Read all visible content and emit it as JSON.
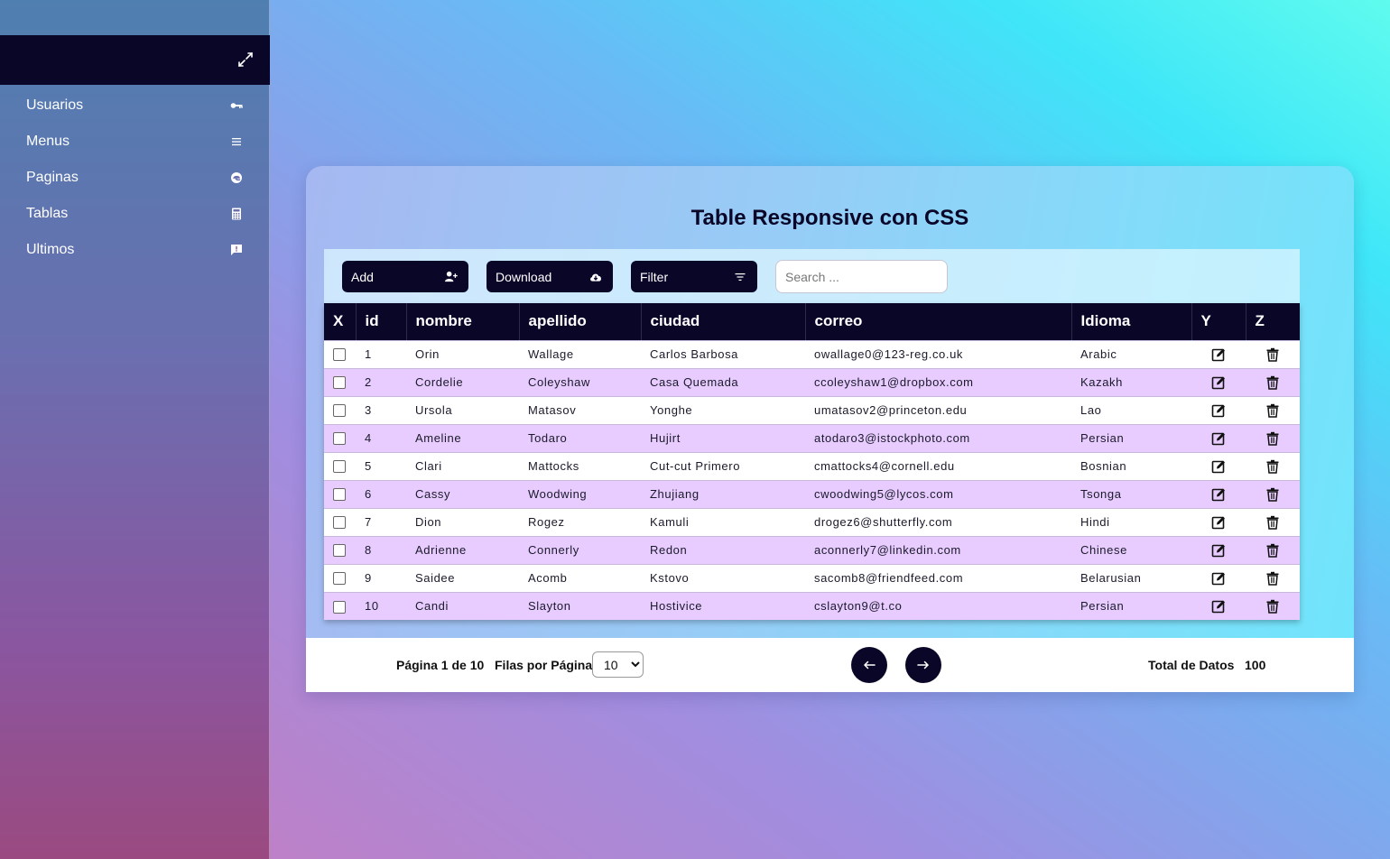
{
  "sidebar": {
    "items": [
      {
        "label": "Usuarios",
        "icon": "key-icon"
      },
      {
        "label": "Menus",
        "icon": "bars-icon"
      },
      {
        "label": "Paginas",
        "icon": "edge-icon"
      },
      {
        "label": "Tablas",
        "icon": "calculator-icon"
      },
      {
        "label": "Ultimos",
        "icon": "comment-alert-icon"
      }
    ]
  },
  "card": {
    "title": "Table Responsive con CSS"
  },
  "toolbar": {
    "add_label": "Add",
    "download_label": "Download",
    "filter_label": "Filter",
    "search_placeholder": "Search ..."
  },
  "table": {
    "headers": [
      "X",
      "id",
      "nombre",
      "apellido",
      "ciudad",
      "correo",
      "Idioma",
      "Y",
      "Z"
    ],
    "rows": [
      {
        "id": "1",
        "nombre": "Orin",
        "apellido": "Wallage",
        "ciudad": "Carlos Barbosa",
        "correo": "owallage0@123-reg.co.uk",
        "idioma": "Arabic"
      },
      {
        "id": "2",
        "nombre": "Cordelie",
        "apellido": "Coleyshaw",
        "ciudad": "Casa Quemada",
        "correo": "ccoleyshaw1@dropbox.com",
        "idioma": "Kazakh"
      },
      {
        "id": "3",
        "nombre": "Ursola",
        "apellido": "Matasov",
        "ciudad": "Yonghe",
        "correo": "umatasov2@princeton.edu",
        "idioma": "Lao"
      },
      {
        "id": "4",
        "nombre": "Ameline",
        "apellido": "Todaro",
        "ciudad": "Hujirt",
        "correo": "atodaro3@istockphoto.com",
        "idioma": "Persian"
      },
      {
        "id": "5",
        "nombre": "Clari",
        "apellido": "Mattocks",
        "ciudad": "Cut-cut Primero",
        "correo": "cmattocks4@cornell.edu",
        "idioma": "Bosnian"
      },
      {
        "id": "6",
        "nombre": "Cassy",
        "apellido": "Woodwing",
        "ciudad": "Zhujiang",
        "correo": "cwoodwing5@lycos.com",
        "idioma": "Tsonga"
      },
      {
        "id": "7",
        "nombre": "Dion",
        "apellido": "Rogez",
        "ciudad": "Kamuli",
        "correo": "drogez6@shutterfly.com",
        "idioma": "Hindi"
      },
      {
        "id": "8",
        "nombre": "Adrienne",
        "apellido": "Connerly",
        "ciudad": "Redon",
        "correo": "aconnerly7@linkedin.com",
        "idioma": "Chinese"
      },
      {
        "id": "9",
        "nombre": "Saidee",
        "apellido": "Acomb",
        "ciudad": "Kstovo",
        "correo": "sacomb8@friendfeed.com",
        "idioma": "Belarusian"
      },
      {
        "id": "10",
        "nombre": "Candi",
        "apellido": "Slayton",
        "ciudad": "Hostivice",
        "correo": "cslayton9@t.co",
        "idioma": "Persian"
      }
    ]
  },
  "footer": {
    "page_info": "Página 1 de 10",
    "rows_per_page_label": "Filas por Página",
    "rows_per_page_value": "10",
    "total_label": "Total de Datos",
    "total_value": "100"
  },
  "colors": {
    "navy": "#0a0628",
    "row_alt": "#e8ccff"
  }
}
